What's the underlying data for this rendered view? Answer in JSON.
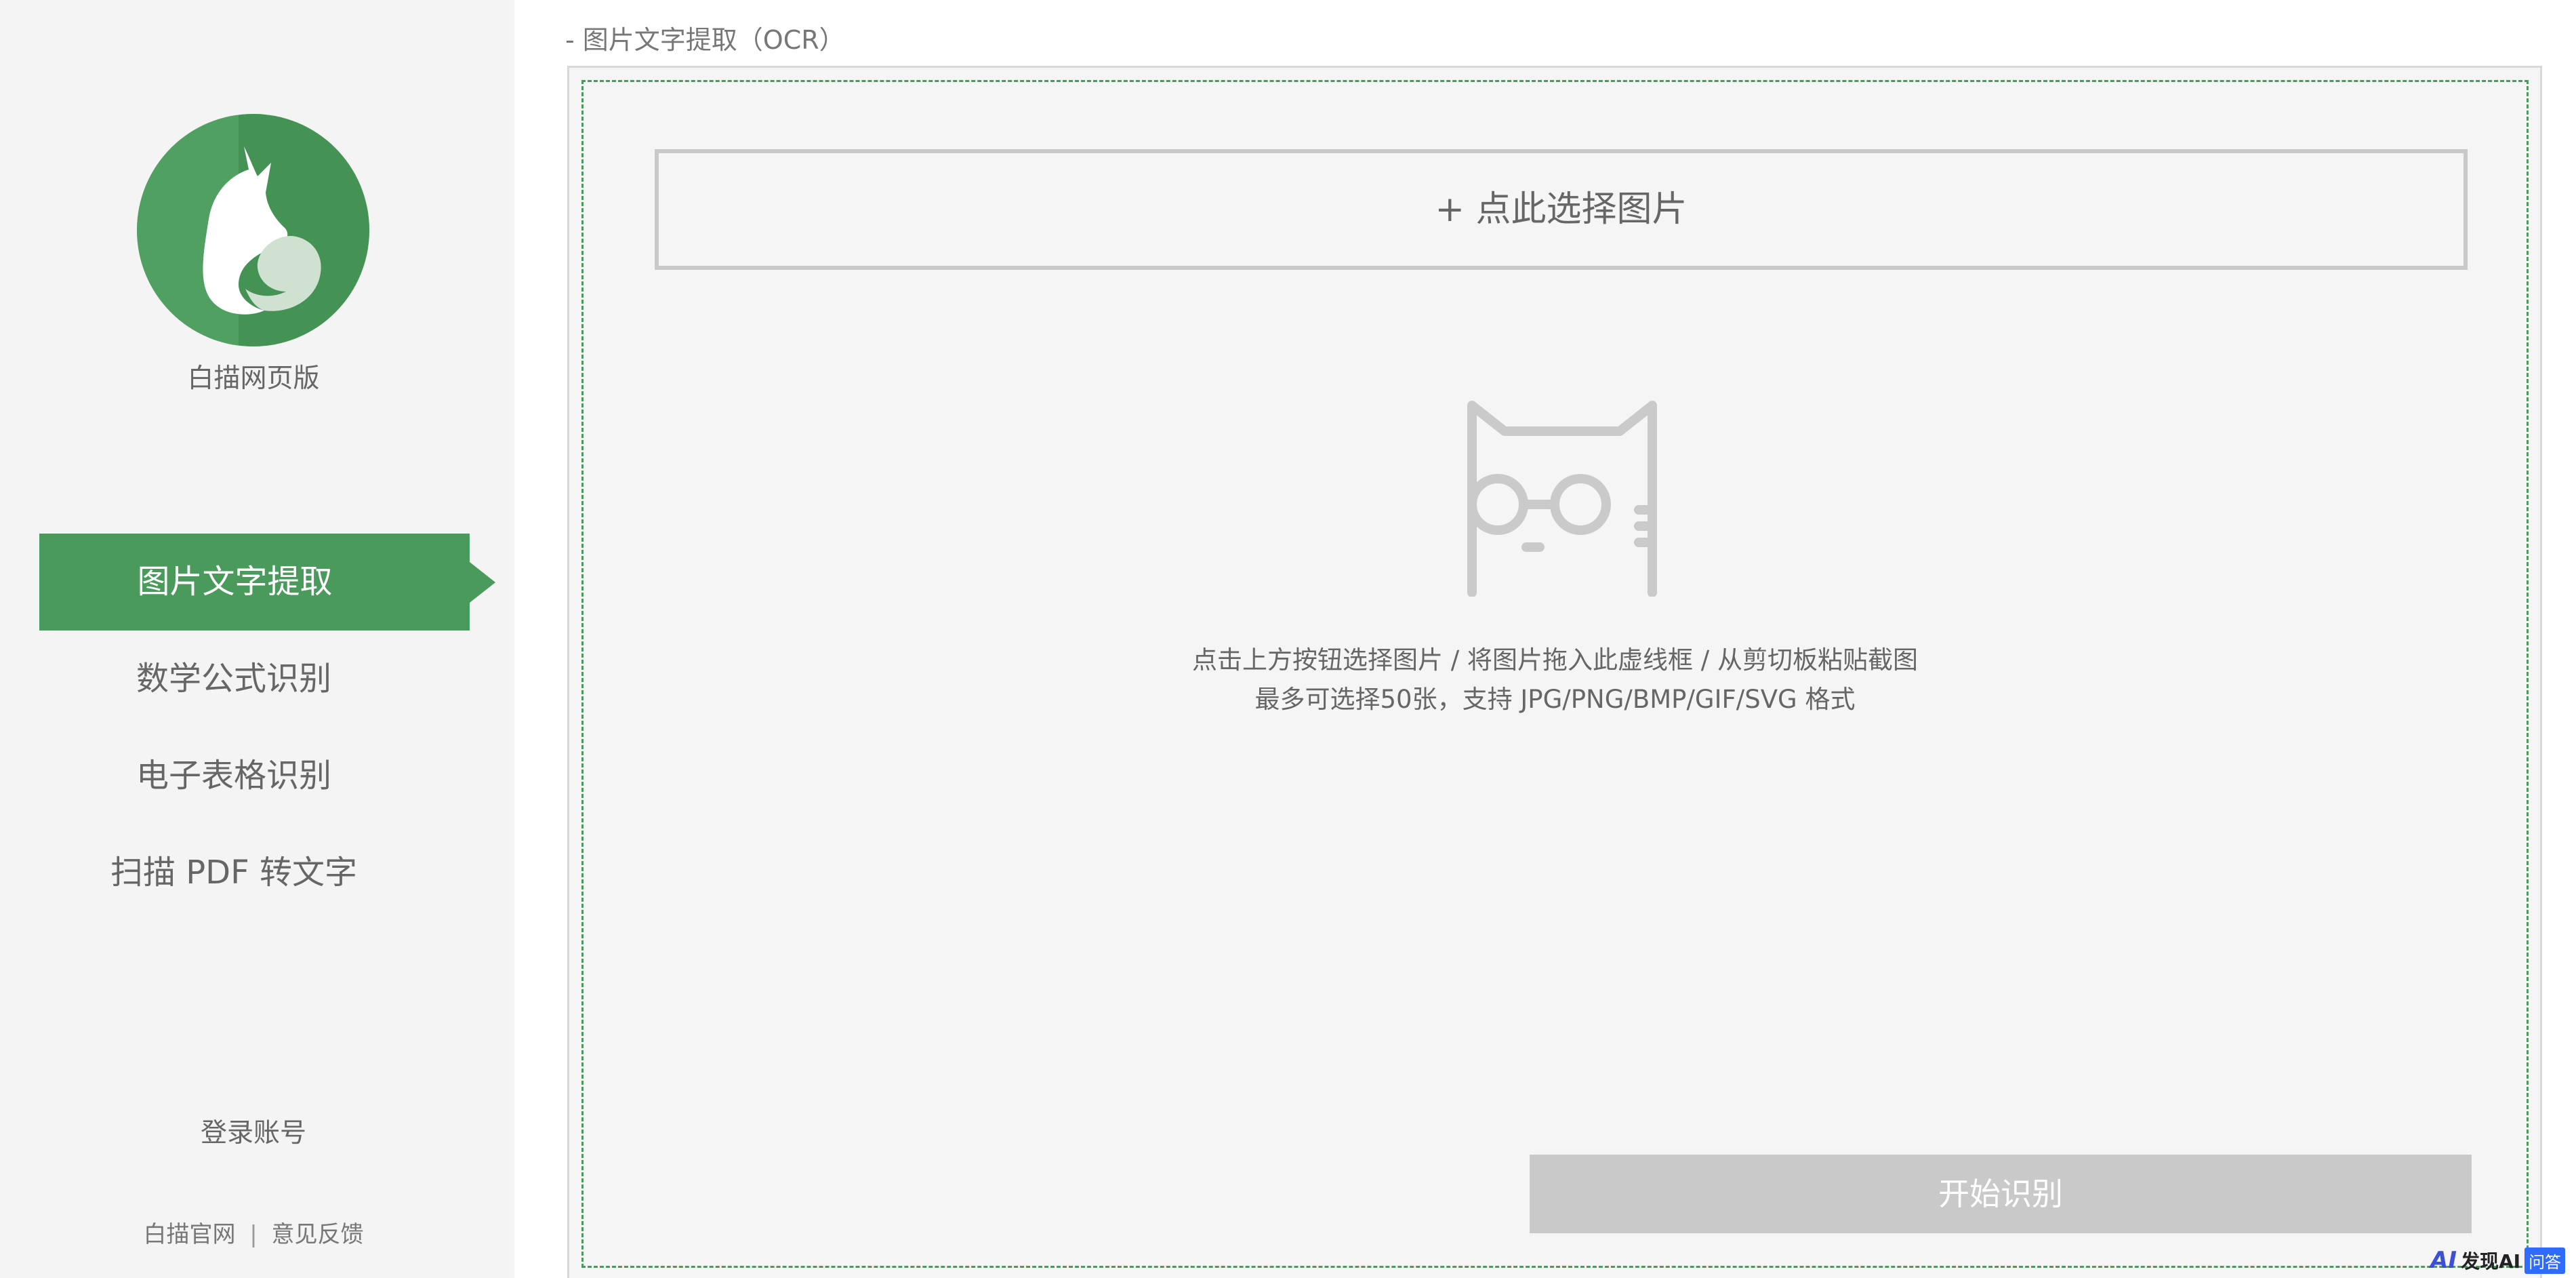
{
  "sidebar": {
    "logo_title": "白描网页版",
    "nav_items": [
      {
        "label": "图片文字提取",
        "active": true
      },
      {
        "label": "数学公式识别",
        "active": false
      },
      {
        "label": "电子表格识别",
        "active": false
      },
      {
        "label": "扫描 PDF 转文字",
        "active": false
      }
    ],
    "login_label": "登录账号",
    "footer": {
      "site_link": "白描官网",
      "separator": "|",
      "feedback_link": "意见反馈"
    }
  },
  "main": {
    "breadcrumb": "- 图片文字提取（OCR）",
    "select_button_label": "+ 点此选择图片",
    "hint_line1": "点击上方按钮选择图片 / 将图片拖入此虚线框 / 从剪切板粘贴截图",
    "hint_line2": "最多可选择50张，支持 JPG/PNG/BMP/GIF/SVG 格式",
    "start_button_label": "开始识别"
  },
  "watermark": {
    "ai_mark": "AI",
    "brand": "发现AI",
    "tag": "问答"
  },
  "colors": {
    "accent": "#4a9a5b",
    "sidebar_bg": "#f4f4f4",
    "panel_bg": "#f4f5f4",
    "disabled_button": "#c9c9c9",
    "text_gray": "#666666"
  }
}
